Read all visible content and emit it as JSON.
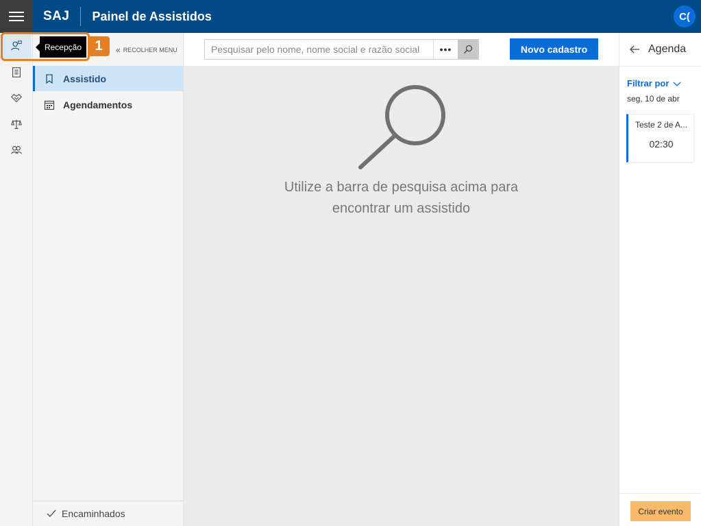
{
  "header": {
    "brand": "SAJ",
    "title": "Painel de Assistidos",
    "avatar_initials": "C("
  },
  "rail": {
    "items": [
      "person-icon",
      "clipboard-icon",
      "handshake-icon",
      "scale-icon",
      "group-icon"
    ],
    "active": "Recepção",
    "tooltip": "Recepção",
    "step_badge": "1"
  },
  "nav": {
    "collapse_label": "RECOLHER MENU",
    "items": [
      {
        "label": "Assistido",
        "icon": "bookmark-icon",
        "active": true
      },
      {
        "label": "Agendamentos",
        "icon": "calendar-icon",
        "active": false
      }
    ],
    "footer_label": "Encaminhados"
  },
  "search": {
    "placeholder": "Pesquisar pelo nome, nome social e razão social",
    "more_label": "•••",
    "new_button": "Novo cadastro"
  },
  "empty_state": {
    "line1": "Utilize a barra de pesquisa acima para",
    "line2": "encontrar um assistido"
  },
  "agenda": {
    "title": "Agenda",
    "filter_label": "Filtrar por",
    "date": "seg, 10 de abr",
    "events": [
      {
        "title": "Teste 2 de A...",
        "time": "02:30"
      }
    ],
    "create_button": "Criar evento"
  },
  "colors": {
    "header_bg": "#004b87",
    "accent": "#0a6cd6",
    "callout": "#e47f22",
    "create_button": "#f7b96a"
  }
}
